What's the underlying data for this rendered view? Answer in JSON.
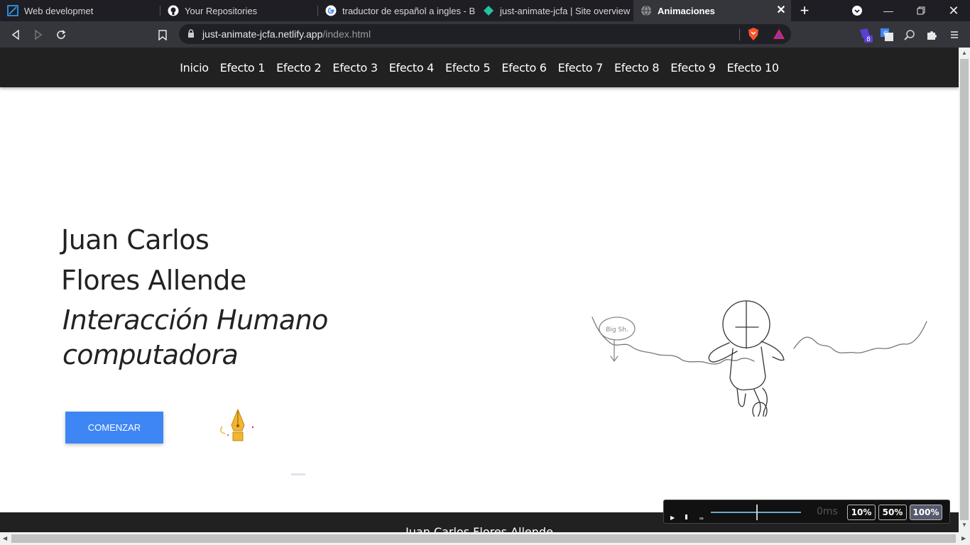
{
  "browser": {
    "tabs": [
      {
        "title": "Web developmet",
        "icon": "web-dev-icon"
      },
      {
        "title": "Your Repositories",
        "icon": "github-icon"
      },
      {
        "title": "traductor de español a ingles - Bus",
        "icon": "google-icon"
      },
      {
        "title": "just-animate-jcfa | Site overview",
        "icon": "netlify-icon"
      },
      {
        "title": "Animaciones",
        "icon": "globe-icon"
      }
    ],
    "url_host": "just-animate-jcfa.netlify.app",
    "url_path": "/index.html",
    "extension_badge": "8"
  },
  "nav": {
    "items": [
      "Inicio",
      "Efecto 1",
      "Efecto 2",
      "Efecto 3",
      "Efecto 4",
      "Efecto 5",
      "Efecto 6",
      "Efecto 7",
      "Efecto 8",
      "Efecto 9",
      "Efecto 10"
    ]
  },
  "hero": {
    "name_line1": "Juan Carlos",
    "name_line2": "Flores Allende",
    "subtitle": "Interacción Humano computadora",
    "button": "COMENZAR",
    "sign_text": "Big Sh."
  },
  "footer": {
    "text": "Juan Carlos Flores Allende"
  },
  "timeline": {
    "time": "0ms",
    "speeds": [
      "10%",
      "50%",
      "100%"
    ],
    "active_speed": "100%"
  },
  "colors": {
    "nav_bg": "#212121",
    "button_bg": "#3f86f5",
    "tab_bg": "#1e1e24",
    "toolbar_bg": "#35363c"
  }
}
